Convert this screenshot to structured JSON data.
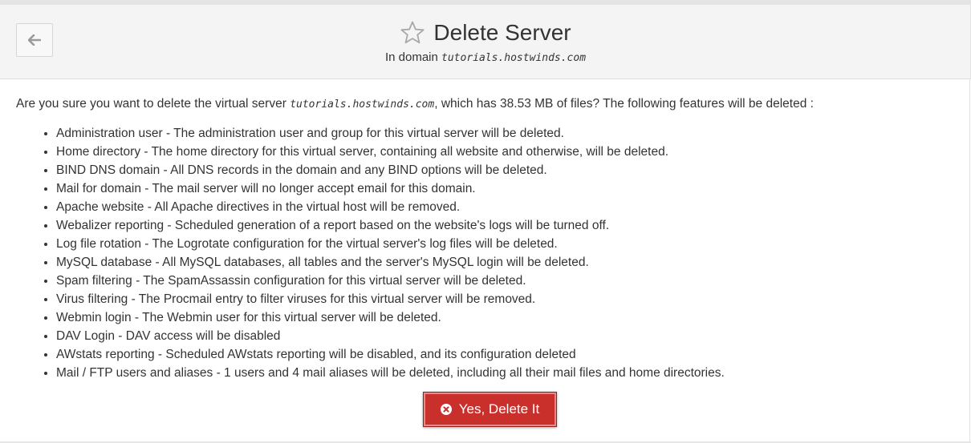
{
  "header": {
    "title": "Delete Server",
    "subtitle_prefix": "In domain ",
    "domain": "tutorials.hostwinds.com",
    "icons": {
      "back": "arrow-left-icon",
      "favorite": "star-outline-icon"
    }
  },
  "content": {
    "intro_before": "Are you sure you want to delete the virtual server ",
    "intro_domain": "tutorials.hostwinds.com",
    "intro_after": ", which has 38.53 MB of files? The following features will be deleted :",
    "features": [
      "Administration user - The administration user and group for this virtual server will be deleted.",
      "Home directory - The home directory for this virtual server, containing all website and otherwise, will be deleted.",
      "BIND DNS domain - All DNS records in the domain and any BIND options will be deleted.",
      "Mail for domain - The mail server will no longer accept email for this domain.",
      "Apache website - All Apache directives in the virtual host will be removed.",
      "Webalizer reporting - Scheduled generation of a report based on the website's logs will be turned off.",
      "Log file rotation - The Logrotate configuration for the virtual server's log files will be deleted.",
      "MySQL database - All MySQL databases, all tables and the server's MySQL login will be deleted.",
      "Spam filtering - The SpamAssassin configuration for this virtual server will be deleted.",
      "Virus filtering - The Procmail entry to filter viruses for this virtual server will be removed.",
      "Webmin login - The Webmin user for this virtual server will be deleted.",
      "DAV Login - DAV access will be disabled",
      "AWstats reporting - Scheduled AWstats reporting will be disabled, and its configuration deleted",
      "Mail / FTP users and aliases - 1 users and 4 mail aliases will be deleted, including all their mail files and home directories."
    ]
  },
  "actions": {
    "confirm_label": "Yes, Delete It",
    "confirm_icon": "times-circle-icon",
    "confirm_color": "#c9302c"
  }
}
